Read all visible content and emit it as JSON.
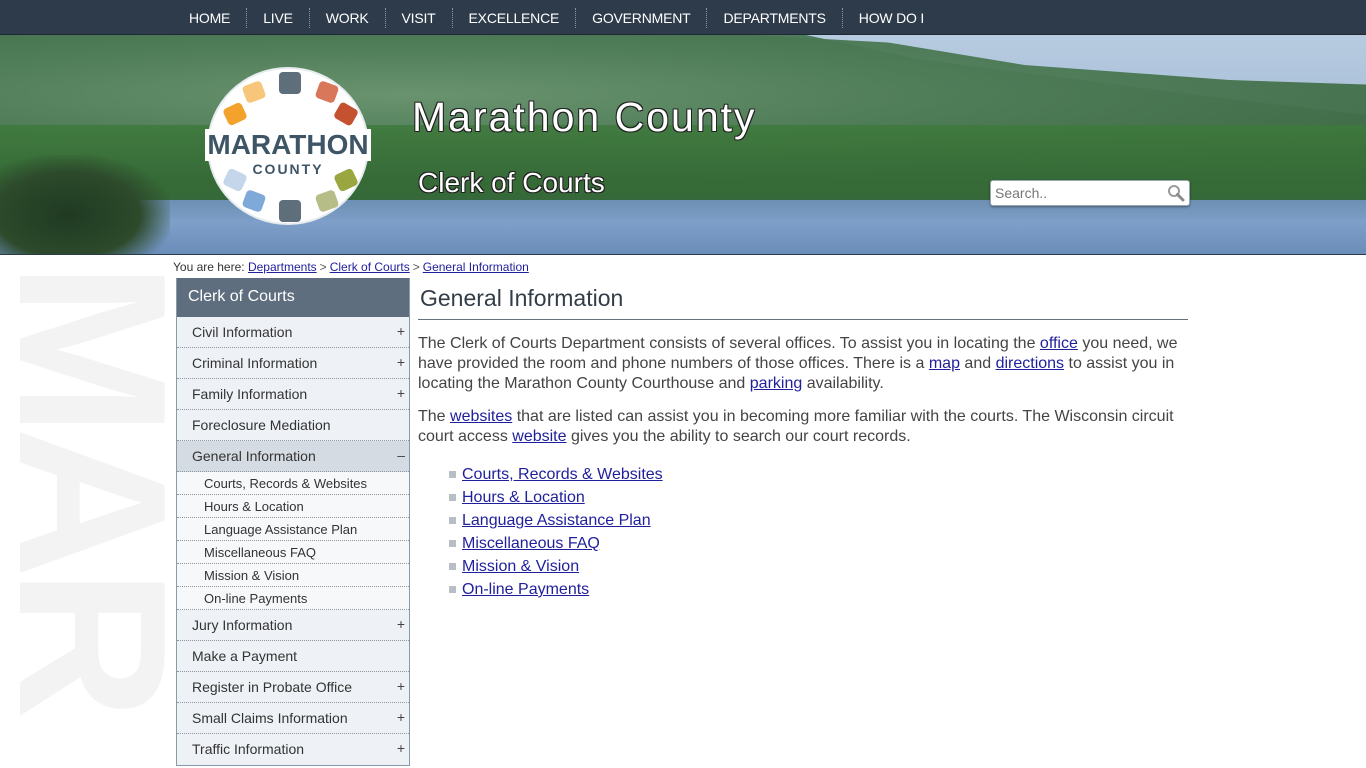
{
  "nav": {
    "items": [
      {
        "label": "HOME"
      },
      {
        "label": "LIVE"
      },
      {
        "label": "WORK"
      },
      {
        "label": "VISIT"
      },
      {
        "label": "EXCELLENCE"
      },
      {
        "label": "GOVERNMENT"
      },
      {
        "label": "DEPARTMENTS"
      },
      {
        "label": "HOW DO I"
      }
    ]
  },
  "header": {
    "logo_main": "MARATHON",
    "logo_sub": "COUNTY",
    "site_title": "Marathon County",
    "dept_title": "Clerk of Courts",
    "search_placeholder": "Search..",
    "logo_colors": [
      "#5e6e7a",
      "#d9775a",
      "#c4512f",
      "#9aa640",
      "#b6bd86",
      "#5e6e7a",
      "#7ea9d8",
      "#c5d6ea",
      "#f3a32c",
      "#f7c67a"
    ]
  },
  "watermark": "MAR",
  "breadcrumb": {
    "prefix": "You are here:",
    "sep": ">",
    "links": [
      "Departments",
      "Clerk of Courts",
      "General Information"
    ]
  },
  "sidebar": {
    "heading": "Clerk of Courts",
    "items_before": [
      {
        "label": "Civil Information",
        "toggle": "+"
      },
      {
        "label": "Criminal Information",
        "toggle": "+"
      },
      {
        "label": "Family Information",
        "toggle": "+"
      },
      {
        "label": "Foreclosure Mediation",
        "toggle": ""
      }
    ],
    "active": {
      "label": "General Information",
      "toggle": "–"
    },
    "sub_items": [
      "Courts, Records & Websites",
      "Hours & Location",
      "Language Assistance Plan",
      "Miscellaneous FAQ",
      "Mission & Vision",
      "On-line Payments"
    ],
    "items_after": [
      {
        "label": "Jury Information",
        "toggle": "+"
      },
      {
        "label": "Make a Payment",
        "toggle": ""
      },
      {
        "label": "Register in Probate Office",
        "toggle": "+"
      },
      {
        "label": "Small Claims Information",
        "toggle": "+"
      },
      {
        "label": "Traffic Information",
        "toggle": "+"
      }
    ]
  },
  "main": {
    "title": "General Information",
    "p1": {
      "t1": "The Clerk of Courts Department consists of several offices. To assist you in locating the ",
      "l1": "office",
      "t2": " you need, we have provided the room and phone numbers of those offices. There is a ",
      "l2": "map",
      "t3": " and ",
      "l3": "directions",
      "t4": " to assist you in locating the Marathon County Courthouse and ",
      "l4": "parking",
      "t5": " availability."
    },
    "p2": {
      "t1": "The ",
      "l1": "websites",
      "t2": " that are listed can assist you in becoming more familiar with the courts. The Wisconsin circuit court access ",
      "l2": "website",
      "t3": " gives you the ability to search our court records."
    },
    "links": [
      "Courts, Records & Websites",
      "Hours & Location",
      "Language Assistance Plan",
      "Miscellaneous FAQ",
      "Mission & Vision",
      "On-line Payments"
    ]
  }
}
